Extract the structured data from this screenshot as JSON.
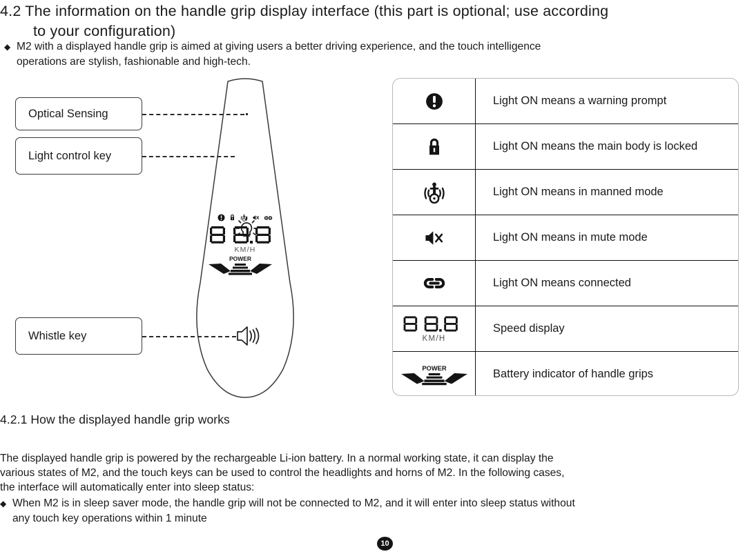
{
  "heading": {
    "line1": "4.2 The information on the handle grip display interface (this part is optional; use according",
    "line2": "to your configuration)"
  },
  "intro": {
    "bullet_mark": "◆",
    "line1": "M2 with a displayed handle grip is aimed at giving users a better driving experience, and the touch intelligence",
    "line2": "operations are stylish, fashionable and high-tech."
  },
  "figure": {
    "callouts": [
      {
        "label": "Optical Sensing",
        "icon": "optical-sensing-dot"
      },
      {
        "label": "Light control key",
        "icon": "light-bulb-icon"
      },
      {
        "label": "Whistle key",
        "icon": "speaker-horn-icon"
      }
    ],
    "lcd": {
      "status_icons": [
        "warning-icon",
        "lock-icon",
        "manned-mode-icon",
        "mute-icon",
        "link-icon"
      ],
      "digits": "8.8.8",
      "unit": "KM/H",
      "power_label": "POWER"
    }
  },
  "legend_table": {
    "rows": [
      {
        "icon": "warning-icon",
        "label": "Light ON means a warning prompt"
      },
      {
        "icon": "lock-icon",
        "label": "Light ON means the main body is locked"
      },
      {
        "icon": "manned-mode-icon",
        "label": "Light ON means in manned mode"
      },
      {
        "icon": "mute-icon",
        "label": "Light ON means in mute mode"
      },
      {
        "icon": "link-icon",
        "label": "Light ON means connected"
      },
      {
        "icon": "speed-display-icon",
        "label": "Speed display",
        "unit": "KM/H"
      },
      {
        "icon": "power-battery-icon",
        "label": "Battery indicator of handle grips",
        "power_label": "POWER"
      }
    ]
  },
  "section": {
    "title": "4.2.1 How the displayed handle grip works",
    "para_line1": "The displayed handle grip is powered by the rechargeable Li-ion battery. In a normal working state, it can display the",
    "para_line2": "various states of M2, and the touch keys can be used to control the headlights and horns of M2. In the following cases,",
    "para_line3": "the interface will automatically enter into sleep status:",
    "bullet_mark": "◆",
    "bullet_line1": "When M2 is in sleep saver mode, the handle grip will not be connected to M2, and it will enter into sleep status without",
    "bullet_line2": "any touch key operations within 1 minute"
  },
  "page_number": "10",
  "colors": {
    "text": "#1a1a1a",
    "outline": "#3a3a3a",
    "table_outer_border": "#b8b8b8",
    "table_inner_border": "#111111",
    "lcd_dim": "#555555"
  }
}
